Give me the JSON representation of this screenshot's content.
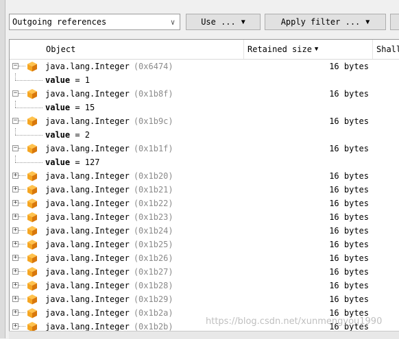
{
  "toolbar": {
    "combo_value": "Outgoing references",
    "use_label": "Use ...",
    "apply_filter_label": "Apply filter ..."
  },
  "columns": {
    "object": "Object",
    "retained_size": "Retained size",
    "shallow": "Shall"
  },
  "rows": [
    {
      "type": "java.lang.Integer",
      "addr": "(0x6474)",
      "size": "16 bytes",
      "expanded": true,
      "field": {
        "name": "value",
        "value": "= 1"
      }
    },
    {
      "type": "java.lang.Integer",
      "addr": "(0x1b8f)",
      "size": "16 bytes",
      "expanded": true,
      "field": {
        "name": "value",
        "value": "= 15"
      }
    },
    {
      "type": "java.lang.Integer",
      "addr": "(0x1b9c)",
      "size": "16 bytes",
      "expanded": true,
      "field": {
        "name": "value",
        "value": "= 2"
      }
    },
    {
      "type": "java.lang.Integer",
      "addr": "(0x1b1f)",
      "size": "16 bytes",
      "expanded": true,
      "field": {
        "name": "value",
        "value": "= 127"
      }
    },
    {
      "type": "java.lang.Integer",
      "addr": "(0x1b20)",
      "size": "16 bytes",
      "expanded": false
    },
    {
      "type": "java.lang.Integer",
      "addr": "(0x1b21)",
      "size": "16 bytes",
      "expanded": false
    },
    {
      "type": "java.lang.Integer",
      "addr": "(0x1b22)",
      "size": "16 bytes",
      "expanded": false
    },
    {
      "type": "java.lang.Integer",
      "addr": "(0x1b23)",
      "size": "16 bytes",
      "expanded": false
    },
    {
      "type": "java.lang.Integer",
      "addr": "(0x1b24)",
      "size": "16 bytes",
      "expanded": false
    },
    {
      "type": "java.lang.Integer",
      "addr": "(0x1b25)",
      "size": "16 bytes",
      "expanded": false
    },
    {
      "type": "java.lang.Integer",
      "addr": "(0x1b26)",
      "size": "16 bytes",
      "expanded": false
    },
    {
      "type": "java.lang.Integer",
      "addr": "(0x1b27)",
      "size": "16 bytes",
      "expanded": false
    },
    {
      "type": "java.lang.Integer",
      "addr": "(0x1b28)",
      "size": "16 bytes",
      "expanded": false
    },
    {
      "type": "java.lang.Integer",
      "addr": "(0x1b29)",
      "size": "16 bytes",
      "expanded": false
    },
    {
      "type": "java.lang.Integer",
      "addr": "(0x1b2a)",
      "size": "16 bytes",
      "expanded": false
    },
    {
      "type": "java.lang.Integer",
      "addr": "(0x1b2b)",
      "size": "16 bytes",
      "expanded": false
    }
  ],
  "watermark": "https://blog.csdn.net/xunmengyou1990",
  "colors": {
    "cube": "#f5a623",
    "cube_dark": "#d9780b",
    "cube_light": "#ffc24d"
  }
}
